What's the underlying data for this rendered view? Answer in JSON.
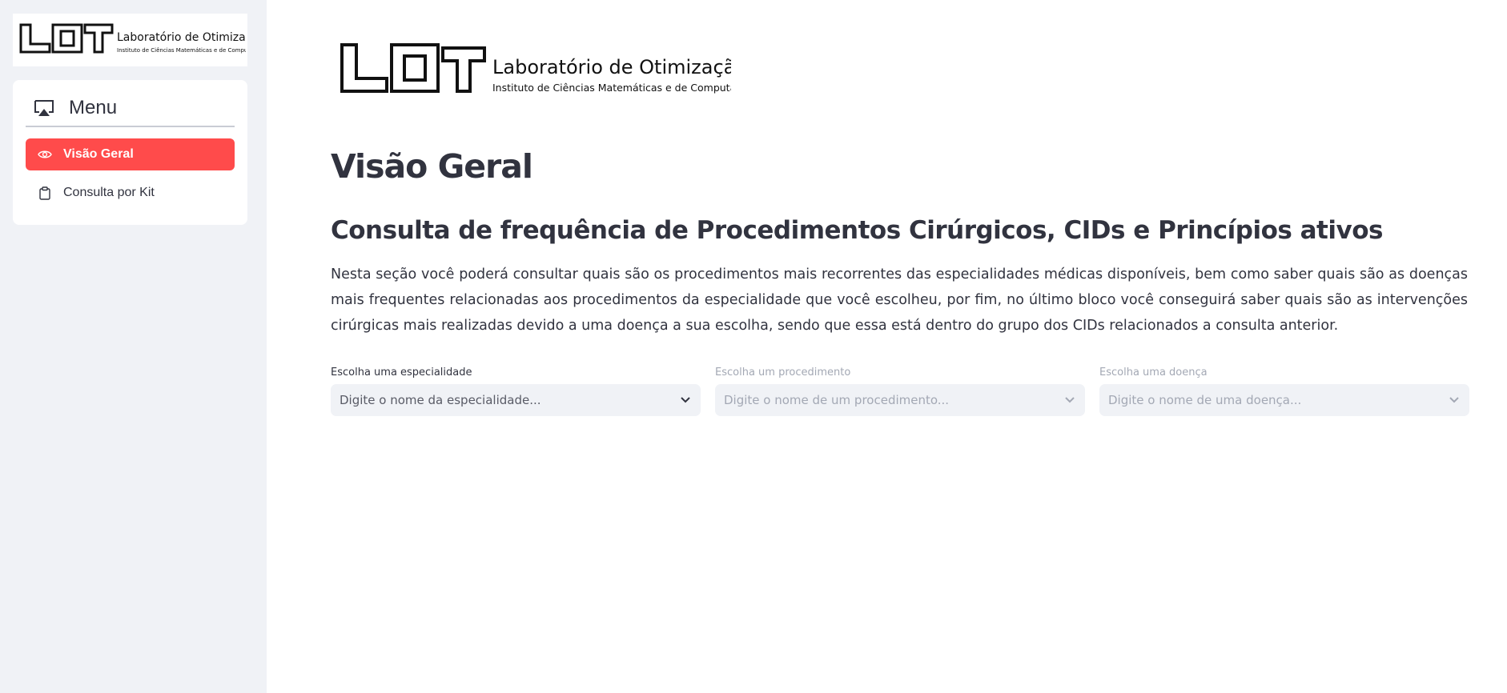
{
  "brand": {
    "lab_name": "Laboratório de Otimização",
    "institute": "Instituto de Ciências Matemáticas e de Computação",
    "logo_mark": "LOT"
  },
  "sidebar": {
    "menu_title": "Menu",
    "items": [
      {
        "label": "Visão Geral",
        "icon": "eye-icon",
        "active": true
      },
      {
        "label": "Consulta por Kit",
        "icon": "clipboard-icon",
        "active": false
      }
    ]
  },
  "main": {
    "page_title": "Visão Geral",
    "section_title": "Consulta de frequência de Procedimentos Cirúrgicos, CIDs e Princípios ativos",
    "description": "Nesta seção você poderá consultar quais são os procedimentos mais recorrentes das especialidades médicas disponíveis, bem como saber quais são as doenças mais frequentes relacionadas aos procedimentos da especialidade que você escolheu, por fim, no último bloco você conseguirá saber quais são as intervenções cirúrgicas mais realizadas devido a uma doença a sua escolha, sendo que essa está dentro do grupo dos CIDs relacionados a consulta anterior.",
    "selects": [
      {
        "label": "Escolha uma especialidade",
        "placeholder": "Digite o nome da especialidade...",
        "enabled": true
      },
      {
        "label": "Escolha um procedimento",
        "placeholder": "Digite o nome de um procedimento...",
        "enabled": false
      },
      {
        "label": "Escolha uma doença",
        "placeholder": "Digite o nome de uma doença...",
        "enabled": false
      }
    ]
  },
  "colors": {
    "accent": "#ff4b4b",
    "sidebar_bg": "#f0f2f6",
    "text": "#31333f",
    "disabled_text": "#a3a8b4"
  }
}
